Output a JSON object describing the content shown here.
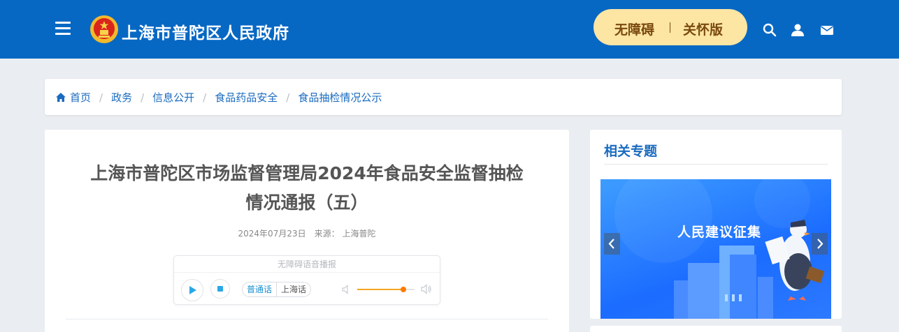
{
  "header": {
    "site_title": "上海市普陀区人民政府",
    "accessibility_button": "无障碍",
    "care_mode_button": "关怀版"
  },
  "breadcrumb": [
    "首页",
    "政务",
    "信息公开",
    "食品药品安全",
    "食品抽检情况公示"
  ],
  "article": {
    "title": "上海市普陀区市场监督管理局2024年食品安全监督抽检情况通报（五）",
    "date": "2024年07月23日",
    "source_label": "来源：",
    "source": "上海普陀"
  },
  "audio_player": {
    "title": "无障碍语音播报",
    "lang_mandarin": "普通话",
    "lang_shanghai": "上海话",
    "volume_fraction": 0.8
  },
  "sidebar": {
    "title": "相关专题",
    "banner_text": "人民建议征集"
  },
  "colors": {
    "header_bg": "#0768c4",
    "accent_blue": "#1a6bbf",
    "pill_bg": "#fde5a3",
    "volume_knob": "#ff7a00"
  }
}
